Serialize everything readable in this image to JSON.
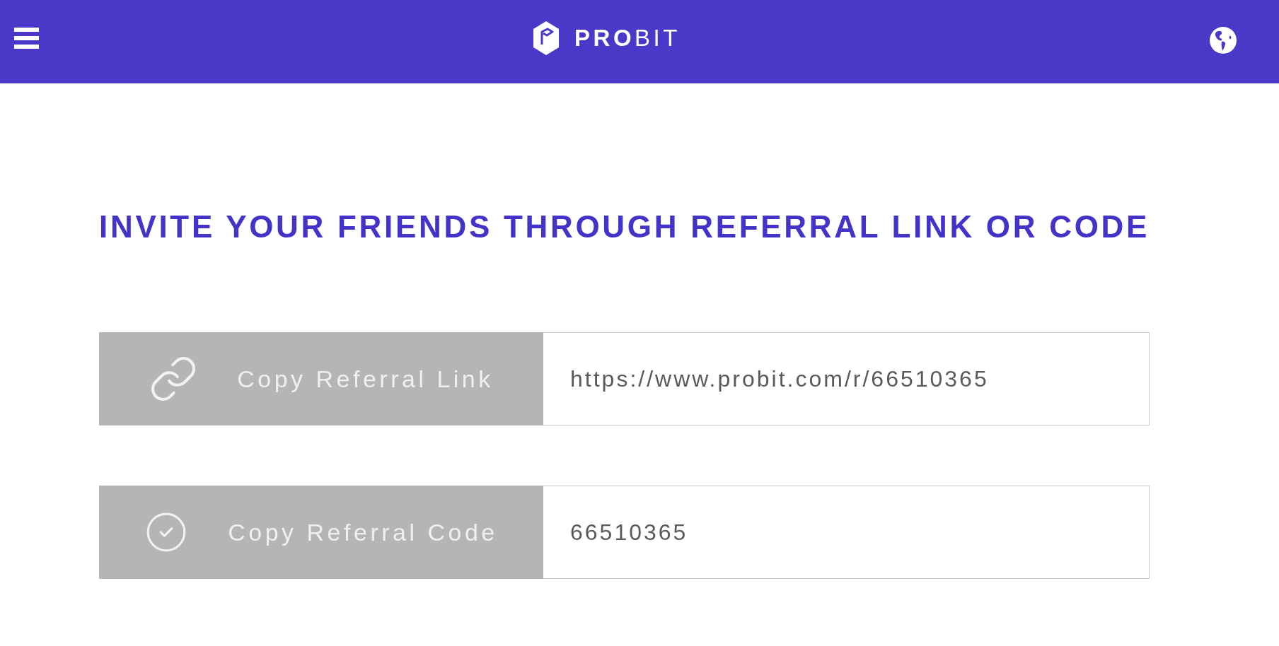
{
  "header": {
    "logo": "**PRO**BIT"
  },
  "title": "INVITE YOUR FRIENDS THROUGH REFERRAL LINK OR CODE",
  "referrals": [
    {
      "kind": "link",
      "button": "Copy Referral Link",
      "value": "https://www.probit.com/r/66510365"
    },
    {
      "kind": "code",
      "button": "Copy Referral Code",
      "value": "66510365"
    }
  ]
}
